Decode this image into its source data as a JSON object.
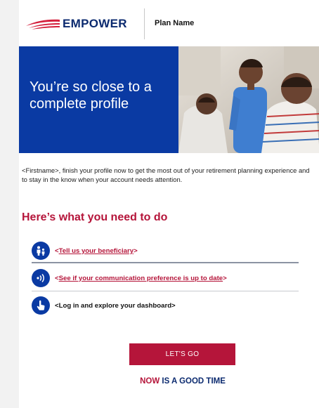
{
  "header": {
    "logo_text": "EMPOWER",
    "plan_name": "Plan Name"
  },
  "hero": {
    "title": "You’re so close to a complete profile"
  },
  "intro": {
    "text": "<Firstname>, finish your profile now to get the most out of your retirement planning experience and to stay in the know when your account needs attention."
  },
  "section": {
    "title": "Here’s what you need to do"
  },
  "steps": [
    {
      "open": "<",
      "label": "Tell us your beneficiary",
      "close": ">",
      "icon": "family-icon"
    },
    {
      "open": "<",
      "label": "See if your communication preference is up to date",
      "close": ">",
      "icon": "sound-icon"
    },
    {
      "label": "<Log in and explore your dashboard>",
      "icon": "pointer-hand-icon"
    }
  ],
  "cta": {
    "label": "LET'S GO"
  },
  "tagline": {
    "accent": "NOW",
    "rest": " IS A GOOD TIME"
  },
  "colors": {
    "brand_blue": "#0a3aa3",
    "accent_red": "#b5153a",
    "navy": "#0b2a6f"
  }
}
